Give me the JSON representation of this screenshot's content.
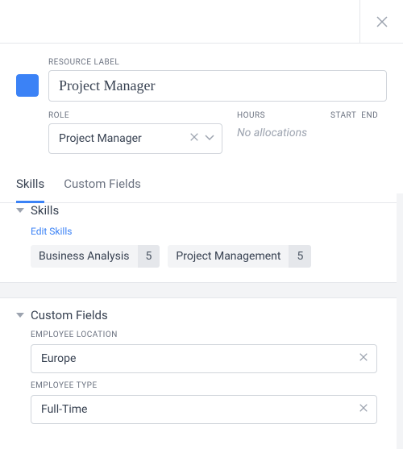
{
  "resource_label_caption": "RESOURCE LABEL",
  "resource_label_value": "Project Manager",
  "role_caption": "ROLE",
  "role_value": "Project Manager",
  "hours_caption": "HOURS",
  "hours_value": "No allocations",
  "start_caption": "START",
  "end_caption": "END",
  "tabs": {
    "skills": "Skills",
    "custom_fields": "Custom Fields"
  },
  "skills_panel": {
    "title": "Skills",
    "edit_link": "Edit Skills",
    "items": [
      {
        "name": "Business Analysis",
        "level": "5"
      },
      {
        "name": "Project Management",
        "level": "5"
      }
    ]
  },
  "custom_fields_panel": {
    "title": "Custom Fields",
    "fields": [
      {
        "label": "EMPLOYEE LOCATION",
        "value": "Europe"
      },
      {
        "label": "EMPLOYEE TYPE",
        "value": "Full-Time"
      }
    ]
  }
}
